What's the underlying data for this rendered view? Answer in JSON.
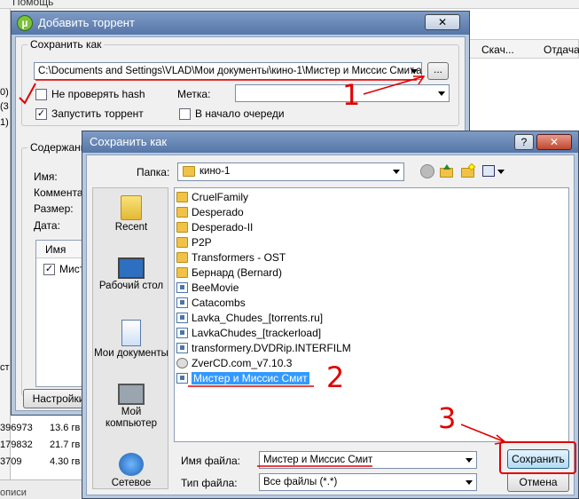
{
  "background": {
    "menu_label": "Помощь",
    "col_download": "Скач...",
    "col_upload": "Отдача",
    "side_labels": [
      "0)",
      "(3",
      "1)"
    ],
    "rows": [
      {
        "num": "396973",
        "size": "13.6 гв"
      },
      {
        "num": "179832",
        "size": "21.7 гв"
      },
      {
        "num": "3709",
        "size": "4.30 гв"
      }
    ],
    "bottom_label": "описи",
    "left_tab": "ст"
  },
  "add_torrent": {
    "title": "Добавить торрент",
    "close_label": "✕",
    "save_as_group": "Сохранить как",
    "path_value": "C:\\Documents and Settings\\VLAD\\Мои документы\\кино-1\\Мистер и Миссис Смит.a",
    "browse_label": "...",
    "no_hash_label": "Не проверять hash",
    "label_label": "Метка:",
    "start_label": "Запустить торрент",
    "queue_label": "В начало очереди",
    "content_group": "Содержание",
    "fields": [
      "Имя:",
      "Коммента",
      "Размер:",
      "Дата:"
    ],
    "list_header": "Имя",
    "list_item": "Мист",
    "settings_button": "Настройки"
  },
  "save_as": {
    "title": "Сохранить как",
    "help_label": "?",
    "close_label": "✕",
    "folder_label": "Папка:",
    "folder_value": "кино-1",
    "places": [
      "Recent",
      "Рабочий стол",
      "Мои документы",
      "Мой компьютер",
      "Сетевое"
    ],
    "files": [
      {
        "name": "CruelFamily",
        "icon": "folder-icon"
      },
      {
        "name": "Desperado",
        "icon": "folder-icon"
      },
      {
        "name": "Desperado-II",
        "icon": "folder-icon"
      },
      {
        "name": "P2P",
        "icon": "folder-icon"
      },
      {
        "name": "Transformers - OST",
        "icon": "folder-icon"
      },
      {
        "name": "Бернард (Bernard)",
        "icon": "folder-icon"
      },
      {
        "name": "BeeMovie",
        "icon": "video-folder-icon"
      },
      {
        "name": "Catacombs",
        "icon": "video-folder-icon"
      },
      {
        "name": "Lavka_Chudes_[torrents.ru]",
        "icon": "video-folder-icon"
      },
      {
        "name": "LavkaChudes_[trackerload]",
        "icon": "video-folder-icon"
      },
      {
        "name": "transformery.DVDRip.INTERFILM",
        "icon": "video-folder-icon"
      },
      {
        "name": "ZverCD.com_v7.10.3",
        "icon": "disc-icon"
      },
      {
        "name": "Мистер и Миссис Смит",
        "icon": "video-folder-icon"
      }
    ],
    "filename_label": "Имя файла:",
    "filename_value": "Мистер и Миссис Смит",
    "filetype_label": "Тип файла:",
    "filetype_value": "Все файлы (*.*)",
    "save_button": "Сохранить",
    "cancel_button": "Отмена"
  },
  "annotations": {
    "one": "1",
    "two": "2",
    "three": "3",
    "check": "✓"
  }
}
